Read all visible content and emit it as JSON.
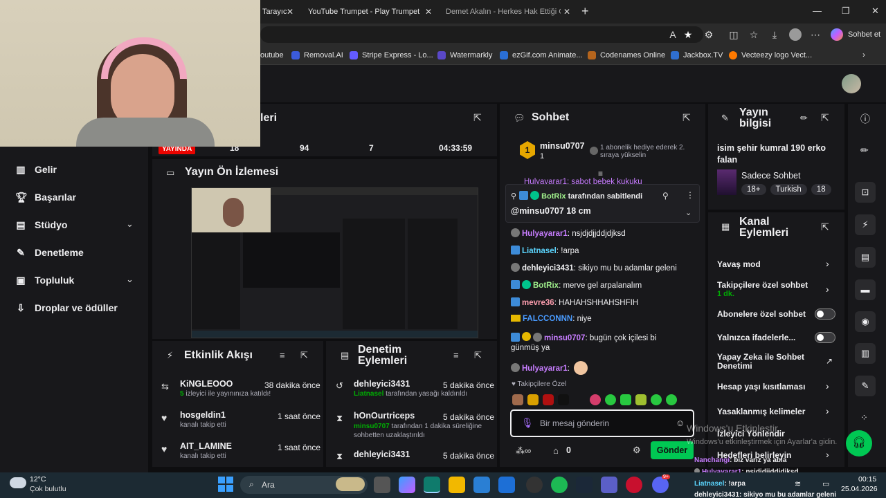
{
  "browser": {
    "tabs": [
      {
        "label": "Tarayıc"
      },
      {
        "label": "YouTube Trumpet - Play Trumpet w"
      },
      {
        "label": "Demet Akalın - Herkes Hak Ettiği G"
      }
    ],
    "copilot_label": "Sohbet et",
    "bookmarks": [
      {
        "label": "outube"
      },
      {
        "label": "Removal.AI"
      },
      {
        "label": "Stripe Express - Lo..."
      },
      {
        "label": "Watermarkly"
      },
      {
        "label": "ezGif.com Animate..."
      },
      {
        "label": "Codenames Online"
      },
      {
        "label": "Jackbox.TV"
      },
      {
        "label": "Vecteezy logo Vect..."
      }
    ]
  },
  "sidebar": {
    "items": [
      {
        "label": "Gelir",
        "icon": "chart-icon"
      },
      {
        "label": "Başarılar",
        "icon": "trophy-icon"
      },
      {
        "label": "Stüdyo",
        "icon": "studio-icon"
      },
      {
        "label": "Denetleme",
        "icon": "wrench-icon"
      },
      {
        "label": "Topluluk",
        "icon": "community-icon"
      },
      {
        "label": "Droplar ve ödüller",
        "icon": "gift-icon"
      }
    ]
  },
  "stats": {
    "title_fragment": "leri",
    "live_badge": "YAYINDA",
    "viewers": "18",
    "followers": "94",
    "subs": "7",
    "uptime": "04:33:59"
  },
  "preview": {
    "title": "Yayın Ön İzlemesi"
  },
  "activity": {
    "title": "Etkinlik Akışı",
    "events": [
      {
        "name": "KiNGLEOOO",
        "time": "38 dakika önce",
        "count": "5",
        "desc": " izleyici ile yayınınıza katıldı!"
      },
      {
        "name": "hosgeldin1",
        "time": "1 saat önce",
        "desc": "kanalı takip etti"
      },
      {
        "name": "AIT_LAMINE",
        "time": "1 saat önce",
        "desc": "kanalı takip etti"
      }
    ]
  },
  "modactions": {
    "title": "Denetim Eylemleri",
    "actions": [
      {
        "name": "dehleyici3431",
        "time": "5 dakika önce",
        "actor": "Liatnasel",
        "desc": " tarafından yasağı kaldırıldı"
      },
      {
        "name": "hOnOurtriceps",
        "time": "5 dakika önce",
        "actor": "minsu0707",
        "desc": " tarafından 1 dakika süreliğine sohbetten uzaklaştırıldı"
      },
      {
        "name": "dehleyici3431",
        "time": "5 dakika önce"
      }
    ]
  },
  "chat": {
    "title": "Sohbet",
    "gift": {
      "user": "minsu0707",
      "count": "1",
      "text": "1 abonelik hediye ederek 2. sıraya yükselin",
      "rank": "1"
    },
    "scrolled_msg": "Hulyayarar1: sabot bebek kukuku",
    "pinned": {
      "by": "BotRix",
      "suffix": " tarafından sabitlendi",
      "text": "@minsu0707 18 cm"
    },
    "messages": [
      {
        "user": "Hulyayarar1",
        "text": ": nsjdjdjjddjdjksd",
        "color": "#c77dff"
      },
      {
        "user": "Liatnasel",
        "text": ": !arpa",
        "color": "#5cd6ff"
      },
      {
        "user": "dehleyici3431",
        "text": ": sikiyo mu bu adamlar geleni",
        "color": "#efeff1"
      },
      {
        "user": "BotRix",
        "text": ": merve gel arpalanalım",
        "color": "#a0f08c"
      },
      {
        "user": "mevre36",
        "text": ": HAHAHSHHAHSHFIH",
        "color": "#ff9fb0"
      },
      {
        "user": "FALCCONNN",
        "text": ": niye",
        "color": "#4a9bff"
      },
      {
        "user": "minsu0707",
        "text": ": bugün çok içilesi bi",
        "text2": "günmüş ya",
        "color": "#c77dff"
      },
      {
        "user": "Hulyayarar1",
        "text": ":",
        "color": "#c77dff"
      }
    ],
    "followers_only": "Takipçilere Özel",
    "placeholder": "Bir mesaj gönderin",
    "points": "0",
    "send": "Gönder"
  },
  "streaminfo": {
    "title": "Yayın bilgisi",
    "stream_title": "isim şehir kumral 190 erko falan",
    "category": "Sadece Sohbet",
    "tags": [
      "18+",
      "Turkish",
      "18"
    ]
  },
  "channel_actions": {
    "title": "Kanal Eylemleri",
    "items": [
      {
        "label": "Yavaş mod",
        "kind": "arrow"
      },
      {
        "label": "Takipçilere özel sohbet",
        "sub": "1 dk.",
        "kind": "arrow"
      },
      {
        "label": "Abonelere özel sohbet",
        "kind": "toggle"
      },
      {
        "label": "Yalnızca ifadelerle...",
        "kind": "toggle"
      },
      {
        "label": "Yapay Zeka ile Sohbet Denetimi",
        "kind": "ext"
      },
      {
        "label": "Hesap yaşı kısıtlaması",
        "kind": "arrow"
      },
      {
        "label": "Yasaklanmış kelimeler",
        "kind": "arrow"
      },
      {
        "label": "İzleyici Yönlendir",
        "kind": "none"
      },
      {
        "label": "Hedefleri belirleyin",
        "kind": "arrow"
      }
    ]
  },
  "watermark": {
    "line1": "Windows'u Etkinleştir",
    "line2": "Windows'u etkinleştirmek için Ayarlar'a gidin."
  },
  "overlay_chat": [
    {
      "user": "Nanchangi",
      "text": ": biz variz ya abla",
      "color": "#c77dff"
    },
    {
      "user": "Hulyayarar1",
      "text": ": nsjdjdjjddjdjksd",
      "color": "#c77dff"
    },
    {
      "user": "Liatnasel",
      "text": ": !arpa",
      "color": "#5cd6ff"
    },
    {
      "user": "dehleyici3431",
      "text": ": sikiyo mu bu adamlar geleni",
      "color": "#efeff1"
    }
  ],
  "taskbar": {
    "temp": "12°C",
    "weather": "Çok bulutlu",
    "search": "Ara",
    "time": "00:15",
    "date": "25.04.2026",
    "badge": "9+"
  }
}
